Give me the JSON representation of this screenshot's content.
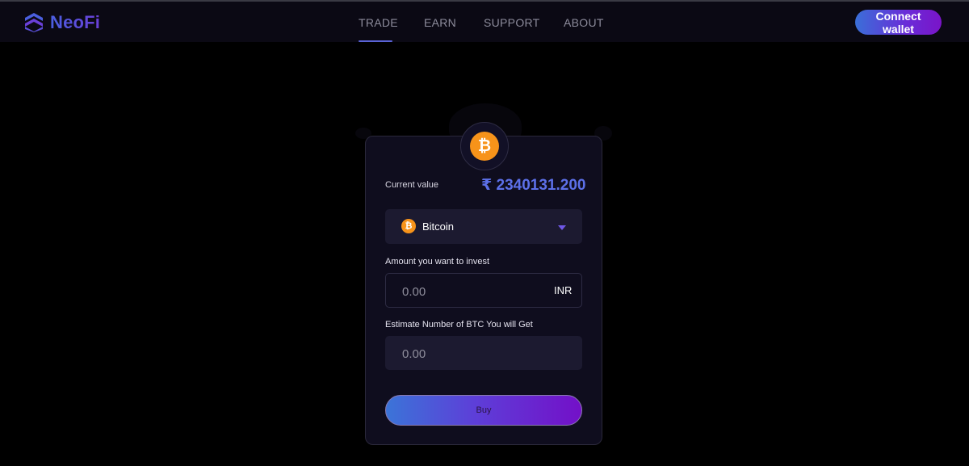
{
  "brand": {
    "name": "NeoFi",
    "logo_icon": "neofi-logo-icon",
    "accent": "#5a63d6"
  },
  "nav": {
    "items": [
      {
        "label": "TRADE",
        "active": true
      },
      {
        "label": "EARN",
        "active": false
      },
      {
        "label": "SUPPORT",
        "active": false
      },
      {
        "label": "ABOUT",
        "active": false
      }
    ]
  },
  "header": {
    "connect_label": "Connect wallet"
  },
  "trade": {
    "coin_icon": "bitcoin-icon",
    "coin_symbol": "₿",
    "current_value_label": "Current value",
    "current_value": "₹ 2340131.200",
    "selected_coin": "Bitcoin",
    "amount_label": "Amount you want to invest",
    "amount_placeholder": "0.00",
    "currency": "INR",
    "estimate_label": "Estimate Number of BTC You will Get",
    "estimate_placeholder": "0.00",
    "buy_label": "Buy"
  },
  "colors": {
    "bitcoin": "#f7931a",
    "value_text": "#5c70e8"
  }
}
